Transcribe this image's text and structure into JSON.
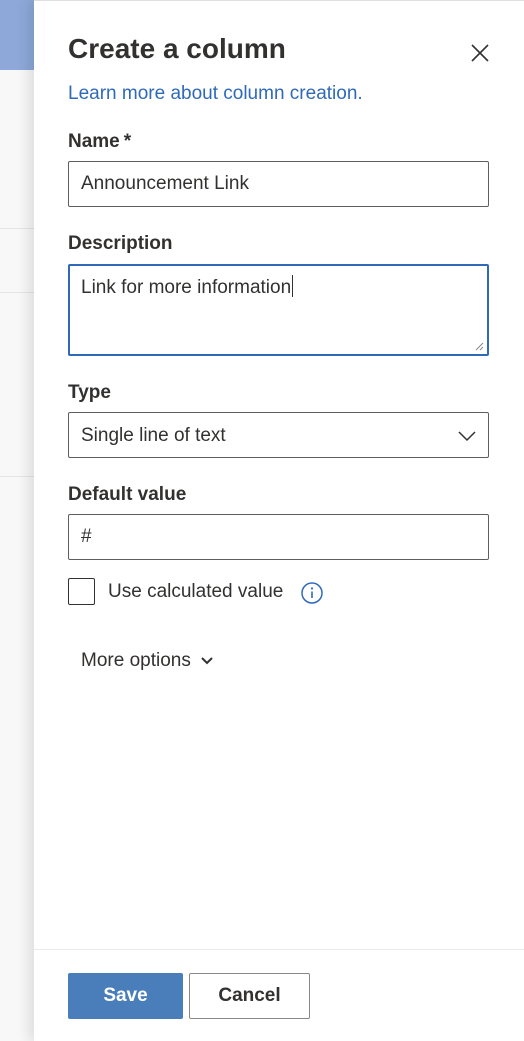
{
  "panel": {
    "title": "Create a column",
    "learn_more_link": "Learn more about column creation.",
    "close_icon": "close-icon"
  },
  "fields": {
    "name": {
      "label": "Name",
      "required_marker": "*",
      "value": "Announcement Link"
    },
    "description": {
      "label": "Description",
      "value": "Link for more information"
    },
    "type": {
      "label": "Type",
      "selected": "Single line of text",
      "icon": "chevron-down-icon"
    },
    "default_value": {
      "label": "Default value",
      "value": "#"
    },
    "calculated": {
      "label": "Use calculated value",
      "checked": false,
      "icon": "info-icon"
    }
  },
  "more_options": {
    "label": "More options",
    "icon": "chevron-down-icon"
  },
  "footer": {
    "save_label": "Save",
    "cancel_label": "Cancel"
  },
  "colors": {
    "accent": "#2f6ab9",
    "primary_button": "#4a7ebb"
  }
}
